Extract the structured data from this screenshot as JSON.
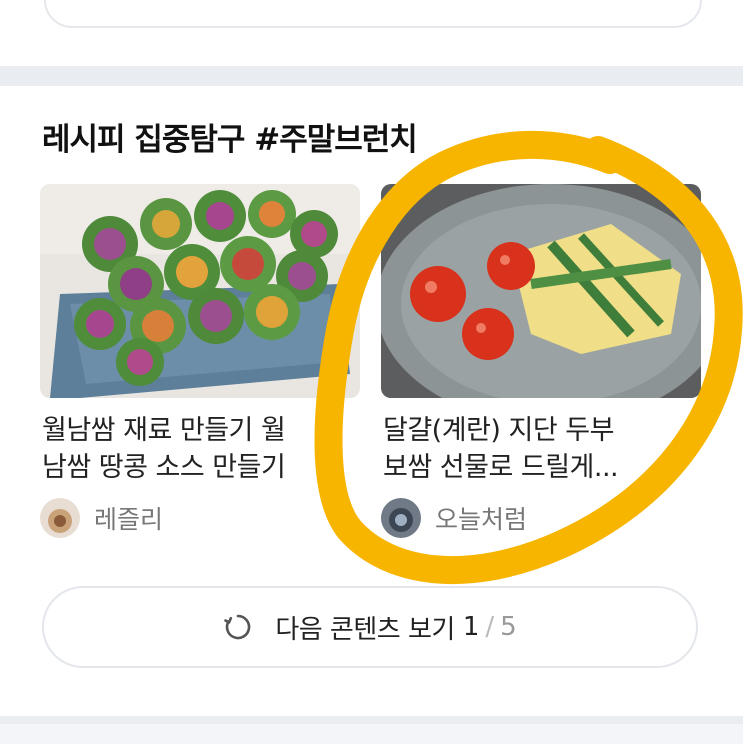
{
  "section": {
    "title": "레시피 집중탐구 #주말브런치"
  },
  "cards": [
    {
      "title_line1": "월남쌈 재료 만들기 월",
      "title_line2": "남쌈 땅콩 소스 만들기",
      "author": "레즐리",
      "image_icon": "spring-rolls-photo"
    },
    {
      "title_line1": "달걀(계란) 지단 두부",
      "title_line2": "보쌈 선물로 드릴게...",
      "author": "오늘처럼",
      "image_icon": "egg-tofu-bossam-photo"
    }
  ],
  "more_button": {
    "label": "다음 콘텐츠 보기",
    "page_current": "1",
    "page_separator": "/",
    "page_total": "5",
    "icon": "refresh-icon"
  },
  "annotation": {
    "color": "#f7b500"
  }
}
